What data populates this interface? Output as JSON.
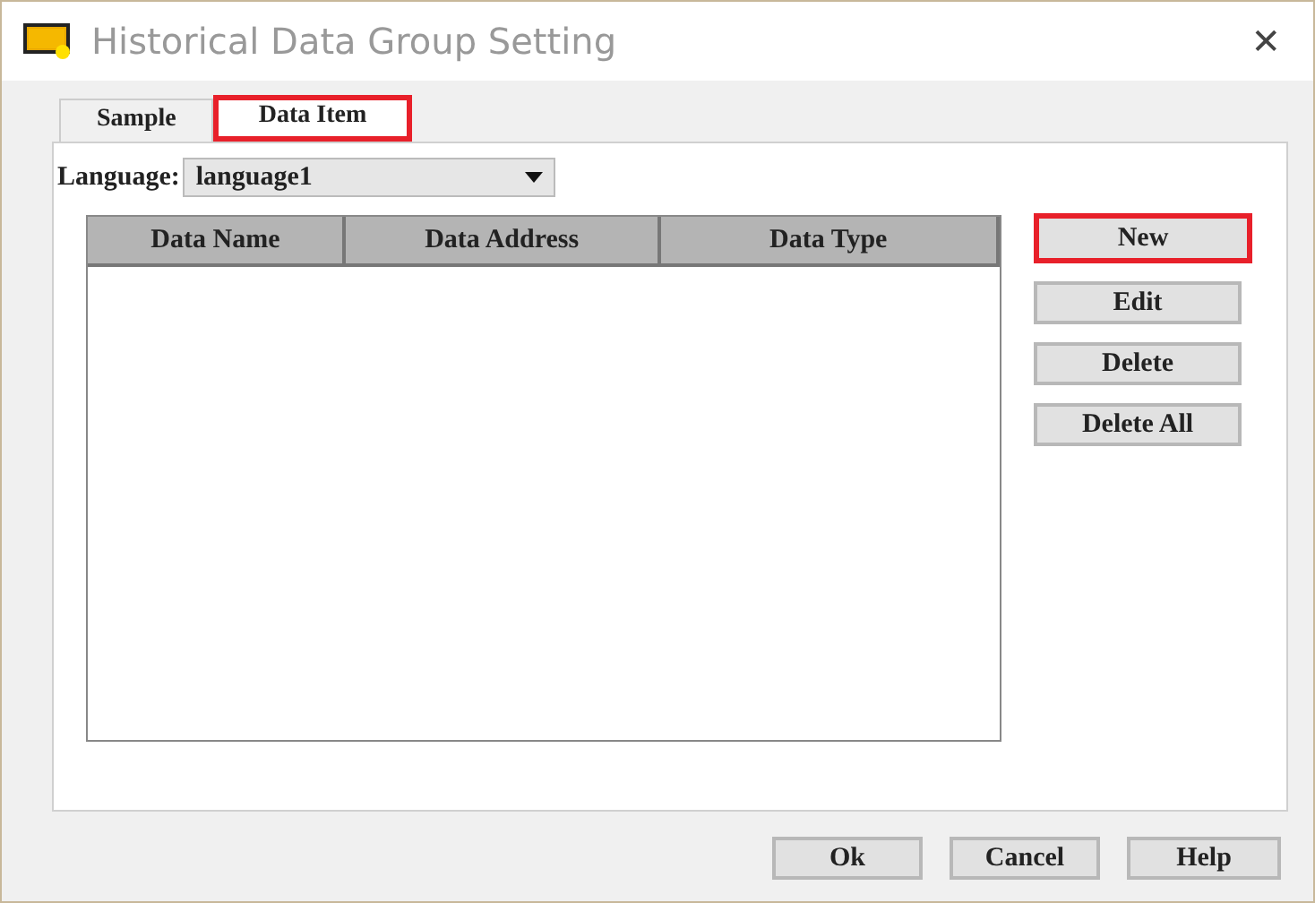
{
  "window": {
    "title": "Historical Data Group Setting",
    "close": "✕"
  },
  "tabs": [
    {
      "label": "Sample",
      "selected": false,
      "highlighted": false
    },
    {
      "label": "Data Item",
      "selected": true,
      "highlighted": true
    }
  ],
  "language": {
    "label": "Language:",
    "value": "language1"
  },
  "table": {
    "columns": [
      "Data Name",
      "Data Address",
      "Data Type"
    ]
  },
  "side_buttons": [
    {
      "label": "New",
      "highlighted": true
    },
    {
      "label": "Edit",
      "highlighted": false
    },
    {
      "label": "Delete",
      "highlighted": false
    },
    {
      "label": "Delete All",
      "highlighted": false
    }
  ],
  "footer_buttons": [
    "Ok",
    "Cancel",
    "Help"
  ]
}
